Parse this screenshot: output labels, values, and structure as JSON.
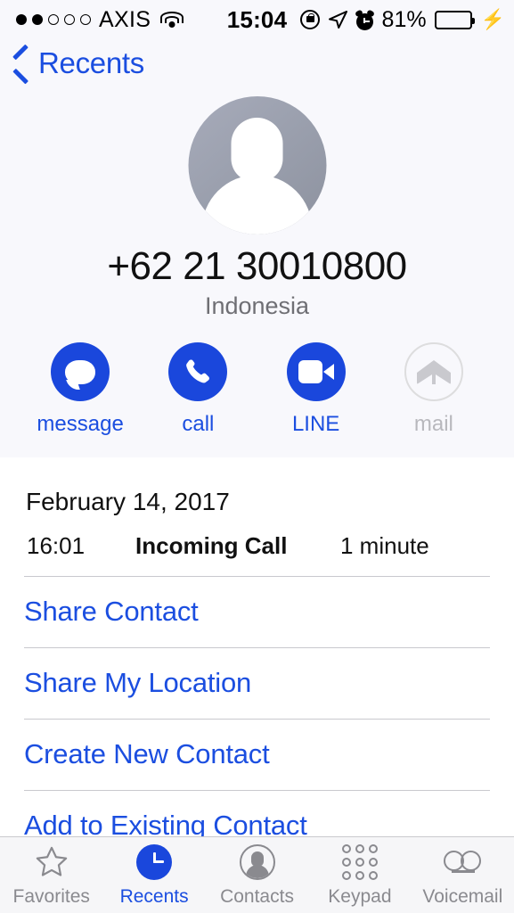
{
  "status_bar": {
    "signal_dots_filled": 2,
    "signal_dots_total": 5,
    "carrier": "AXIS",
    "wifi_icon": "wifi-icon",
    "time": "15:04",
    "rotation_lock_icon": "rotation-lock-icon",
    "location_icon": "location-arrow-icon",
    "alarm_icon": "alarm-clock-icon",
    "battery_percent": "81%",
    "battery_level": 81,
    "battery_color": "#4cd964",
    "charging_icon": "lightning-bolt-icon"
  },
  "nav": {
    "back_label": "Recents",
    "back_icon": "chevron-left-icon",
    "accent_color": "#1b4ee0"
  },
  "contact": {
    "avatar_icon": "default-person-avatar",
    "phone_number": "+62 21 30010800",
    "country": "Indonesia"
  },
  "actions": [
    {
      "label": "message",
      "icon": "message-bubble-icon",
      "enabled": true
    },
    {
      "label": "call",
      "icon": "phone-handset-icon",
      "enabled": true
    },
    {
      "label": "LINE",
      "icon": "video-camera-icon",
      "enabled": true
    },
    {
      "label": "mail",
      "icon": "envelope-icon",
      "enabled": false
    }
  ],
  "call_history": {
    "date": "February 14, 2017",
    "entry": {
      "time": "16:01",
      "type": "Incoming Call",
      "duration": "1 minute"
    }
  },
  "list_actions": [
    {
      "label": "Share Contact"
    },
    {
      "label": "Share My Location"
    },
    {
      "label": "Create New Contact"
    },
    {
      "label": "Add to Existing Contact"
    }
  ],
  "tab_bar": [
    {
      "label": "Favorites",
      "icon": "star-icon",
      "active": false
    },
    {
      "label": "Recents",
      "icon": "clock-icon",
      "active": true
    },
    {
      "label": "Contacts",
      "icon": "person-circle-icon",
      "active": false
    },
    {
      "label": "Keypad",
      "icon": "keypad-dots-icon",
      "active": false
    },
    {
      "label": "Voicemail",
      "icon": "voicemail-icon",
      "active": false
    }
  ]
}
